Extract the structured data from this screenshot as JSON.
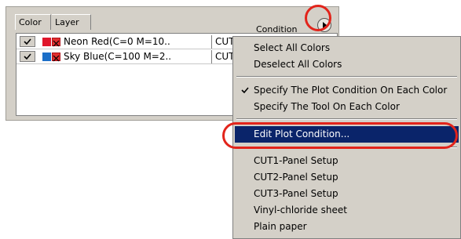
{
  "tabs": [
    {
      "label": "Color"
    },
    {
      "label": "Layer"
    }
  ],
  "table": {
    "header_condition": "Condition",
    "rows": [
      {
        "checked": true,
        "swatch_color": "#e0162b",
        "name": "Neon Red(C=0 M=10..",
        "condition": "CUT1-Panel Setup"
      },
      {
        "checked": true,
        "swatch_color": "#1c6fc8",
        "name": "Sky Blue(C=100 M=2..",
        "condition": "CUT1-Panel Setup"
      }
    ]
  },
  "menu": {
    "items": [
      {
        "label": "Select All Colors",
        "checked": false
      },
      {
        "label": "Deselect All Colors",
        "checked": false
      },
      {
        "label": "Specify The Plot Condition On Each Color",
        "checked": true
      },
      {
        "label": "Specify The Tool On Each Color",
        "checked": false
      },
      {
        "label": "Edit Plot Condition...",
        "checked": false,
        "selected": true
      },
      {
        "label": "CUT1-Panel Setup",
        "checked": false
      },
      {
        "label": "CUT2-Panel Setup",
        "checked": false
      },
      {
        "label": "CUT3-Panel Setup",
        "checked": false
      },
      {
        "label": "Vinyl-chloride sheet",
        "checked": false
      },
      {
        "label": "Plain paper",
        "checked": false
      }
    ]
  },
  "colors": {
    "highlight": "#0a246a",
    "annotation_ring": "#e2241b",
    "panel_bg": "#d4d0c8"
  },
  "icons": {
    "menu_button": "circle-play-icon",
    "checkbox": "checkmark-icon"
  }
}
